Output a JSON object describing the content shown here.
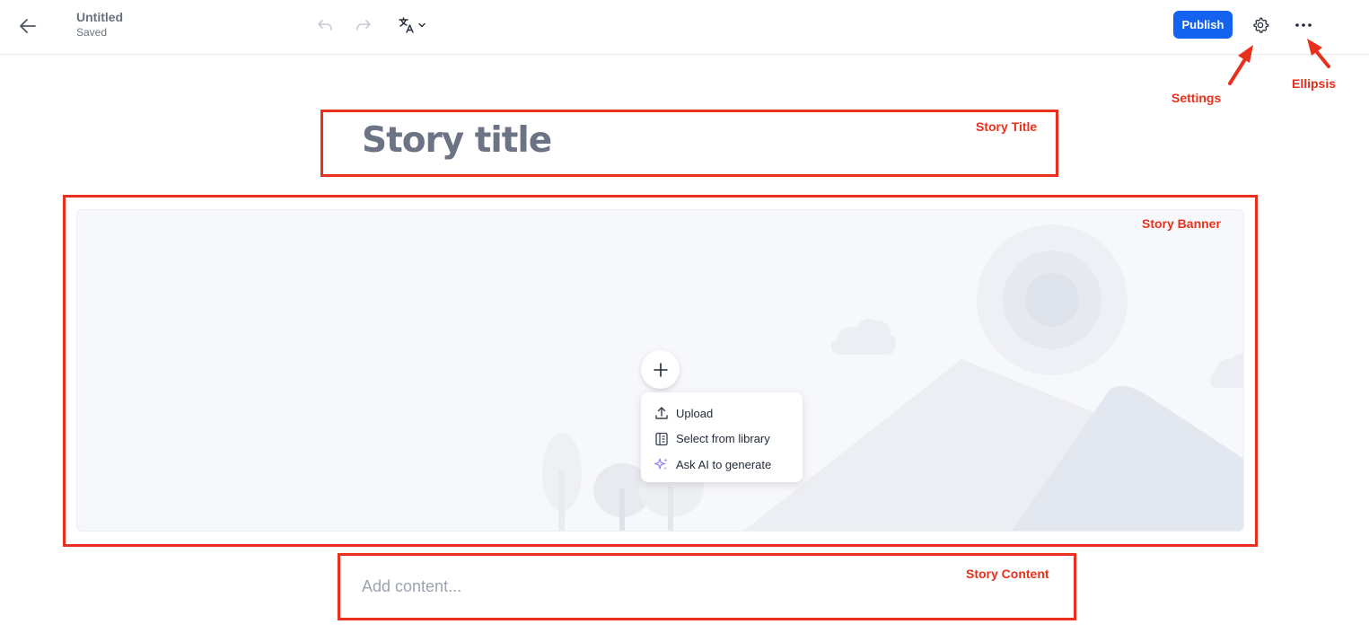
{
  "header": {
    "doc_title": "Untitled",
    "doc_status": "Saved",
    "publish_label": "Publish",
    "icons": {
      "back": "arrow-left-icon",
      "undo": "undo-icon",
      "redo": "redo-icon",
      "translate": "translate-icon",
      "settings": "gear-icon",
      "more": "ellipsis-icon"
    }
  },
  "editor": {
    "title_placeholder": "Story title",
    "content_placeholder": "Add content..."
  },
  "banner": {
    "menu": [
      {
        "label": "Upload",
        "icon": "upload-icon"
      },
      {
        "label": "Select from library",
        "icon": "library-icon"
      },
      {
        "label": "Ask AI to generate",
        "icon": "sparkle-icon"
      }
    ]
  },
  "annotations": {
    "settings": "Settings",
    "ellipsis": "Ellipsis",
    "story_title": "Story Title",
    "story_banner": "Story Banner",
    "story_content": "Story Content"
  },
  "colors": {
    "accent": "#1463ee",
    "annotation": "#e8301c",
    "title_text": "#6b7385"
  }
}
